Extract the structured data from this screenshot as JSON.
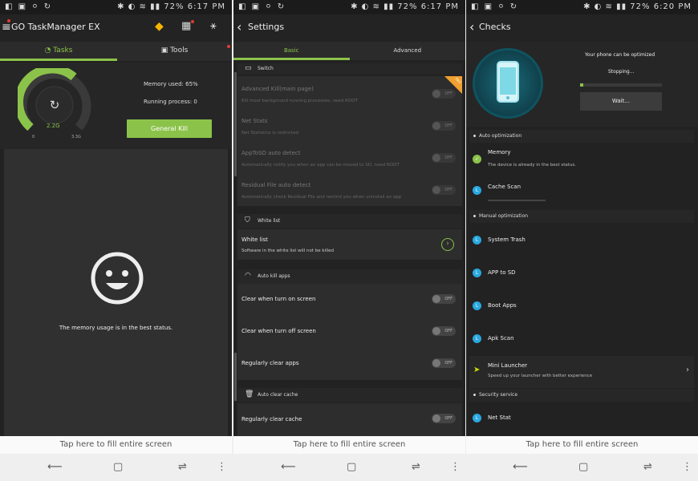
{
  "status_bars": [
    {
      "time": "6:17 PM",
      "battery": "72%",
      "left_icons": "◧ ▣ ⚪ ↻"
    },
    {
      "time": "6:17 PM",
      "battery": "72%",
      "left_icons": "◧ ▣ ⚪ ↻"
    },
    {
      "time": "6:20 PM",
      "battery": "72%",
      "left_icons": "◧ ▣ ⚪ ↻"
    }
  ],
  "screen1": {
    "app_title": "GO TaskManager EX",
    "tabs": [
      "Tasks",
      "Tools"
    ],
    "gauge": {
      "value_label": "2.2G",
      "min_label": "0",
      "max_label": "3.3G",
      "fill_fraction": 0.65
    },
    "memory_used": "Memory used: 65%",
    "running_process": "Running process: 0",
    "kill_button": "General Kill",
    "empty_message": "The memory usage is in the best status."
  },
  "screen2": {
    "title": "Settings",
    "tabs": [
      "Basic",
      "Advanced"
    ],
    "switch_header": "Switch",
    "switch_rows": [
      {
        "title": "Advanced Kill(main page)",
        "desc": "Kill most background running processes, need ROOT",
        "toggle": "OFF"
      },
      {
        "title": "Net Stats",
        "desc": "Net Statistics is restricted",
        "toggle": "OFF"
      },
      {
        "title": "AppToSD auto detect",
        "desc": "Automatically notify you when an app can be moved to SD, need ROOT",
        "toggle": "OFF"
      },
      {
        "title": "Residual File auto detect",
        "desc": "Automatically check Residual File and remind you when uninstall an app",
        "toggle": "OFF"
      }
    ],
    "ribbon": "PRO",
    "white_list_header": "White list",
    "white_list": {
      "title": "White list",
      "desc": "Software in the white list will not be killed"
    },
    "auto_kill_header": "Auto kill apps",
    "auto_kill_rows": [
      {
        "title": "Clear when turn on screen",
        "toggle": "OFF"
      },
      {
        "title": "Clear when turn off screen",
        "toggle": "OFF"
      },
      {
        "title": "Regularly clear apps",
        "toggle": "OFF"
      }
    ],
    "auto_cache_header": "Auto clear cache",
    "auto_cache_rows": [
      {
        "title": "Regularly clear cache",
        "toggle": "OFF"
      }
    ]
  },
  "screen3": {
    "title": "Checks",
    "optimize_text": "Your phone can be optimized",
    "stopping_text": "Stopping...",
    "progress_fraction": 0.04,
    "wait_button": "Wait...",
    "auto_header": "Auto optimization",
    "memory": {
      "title": "Memory",
      "desc": "The device is already in the best status."
    },
    "cache": {
      "title": "Cache Scan"
    },
    "manual_header": "Manual optimization",
    "manual_items": [
      "System Trash",
      "APP to SD",
      "Boot Apps",
      "Apk Scan"
    ],
    "mini_launcher": {
      "title": "Mini Launcher",
      "desc": "Speed up your launcher with better experience"
    },
    "security_header": "Security service",
    "security_items": [
      "Net Stat"
    ]
  },
  "fill_bar": [
    "Tap here to fill entire screen",
    "Tap here to fill entire screen",
    "Tap here to fill entire screen"
  ],
  "colors": {
    "accent": "#8bc34a",
    "background": "#222222",
    "info_icon": "#29a8df",
    "pro_ribbon": "#f0a030"
  },
  "icons": [
    "back-icon",
    "recent-apps-icon",
    "home-icon",
    "return-icon",
    "more-icon",
    "gem-icon",
    "grid-icon",
    "magic-wand-icon"
  ]
}
